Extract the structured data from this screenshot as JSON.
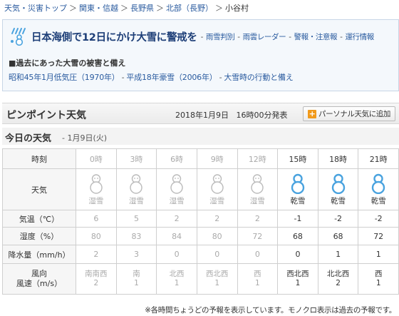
{
  "breadcrumb": [
    {
      "label": "天気・災害トップ",
      "link": true
    },
    {
      "label": "関東・信越",
      "link": true
    },
    {
      "label": "長野県",
      "link": true
    },
    {
      "label": "北部（長野）",
      "link": true
    },
    {
      "label": "小谷村",
      "link": false
    }
  ],
  "breadcrumb_separators": {
    "after_top": "＞",
    "between": "＞"
  },
  "alert": {
    "icon": "snow-warning-icon",
    "headline": "日本海側で12日にかけ大雪に警戒を",
    "links": [
      "雨雪判別",
      "雨雲レーダー",
      "警報・注意報",
      "運行情報"
    ],
    "link_separator": "-",
    "sub_heading": "■過去にあった大雪の被害と備え",
    "sub_links": [
      "昭和45年1月低気圧（1970年）",
      "平成18年豪雪（2006年）",
      "大雪時の行動と備え"
    ]
  },
  "pinpoint": {
    "title": "ピンポイント天気",
    "date": "2018年1月9日",
    "issued": "16時00分発表",
    "button_label": "パーソナル天気に追加",
    "button_icon": "plus-icon"
  },
  "today": {
    "title": "今日の天気",
    "date": "- 1月9日(火)"
  },
  "table": {
    "row_labels": {
      "time": "時刻",
      "weather": "天気",
      "temp": "気温（℃）",
      "humidity": "湿度（%）",
      "precip": "降水量（mm/h）",
      "wind_dir": "風向",
      "wind_speed": "風速（m/s）"
    },
    "columns": [
      {
        "time": "0時",
        "weather": "湿雪",
        "icon": "snowman-icon",
        "temp": "6",
        "humidity": "80",
        "precip": "2",
        "wind_dir": "南南西",
        "wind_speed": "2",
        "past": true
      },
      {
        "time": "3時",
        "weather": "湿雪",
        "icon": "snowman-icon",
        "temp": "5",
        "humidity": "83",
        "precip": "3",
        "wind_dir": "南",
        "wind_speed": "1",
        "past": true
      },
      {
        "time": "6時",
        "weather": "湿雪",
        "icon": "snowman-icon",
        "temp": "2",
        "humidity": "84",
        "precip": "0",
        "wind_dir": "北西",
        "wind_speed": "1",
        "past": true
      },
      {
        "time": "9時",
        "weather": "湿雪",
        "icon": "snowman-icon",
        "temp": "2",
        "humidity": "80",
        "precip": "0",
        "wind_dir": "西北西",
        "wind_speed": "1",
        "past": true
      },
      {
        "time": "12時",
        "weather": "湿雪",
        "icon": "snowman-icon",
        "temp": "2",
        "humidity": "72",
        "precip": "0",
        "wind_dir": "西",
        "wind_speed": "1",
        "past": true
      },
      {
        "time": "15時",
        "weather": "乾雪",
        "icon": "snowman-icon",
        "temp": "-1",
        "humidity": "68",
        "precip": "0",
        "wind_dir": "西北西",
        "wind_speed": "1",
        "past": false
      },
      {
        "time": "18時",
        "weather": "乾雪",
        "icon": "snowman-icon",
        "temp": "-2",
        "humidity": "68",
        "precip": "1",
        "wind_dir": "北北西",
        "wind_speed": "2",
        "past": false
      },
      {
        "time": "21時",
        "weather": "乾雪",
        "icon": "snowman-icon",
        "temp": "-2",
        "humidity": "72",
        "precip": "1",
        "wind_dir": "西",
        "wind_speed": "1",
        "past": false
      }
    ]
  },
  "footnote": "※各時間ちょうどの予報を表示しています。モノクロ表示は過去の予報です。",
  "colors": {
    "link": "#2a5b9f",
    "headline": "#1e3f78",
    "snow_icon_future": "#4aa3df",
    "snow_icon_past": "#bbbbbb",
    "button_plus": "#f19a1b"
  }
}
